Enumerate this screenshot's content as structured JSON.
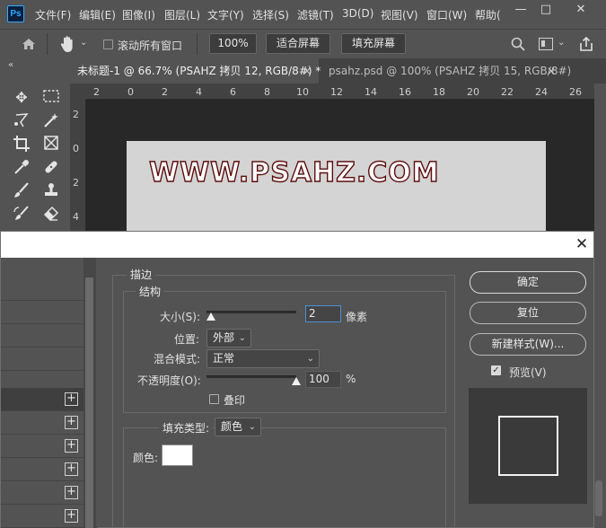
{
  "app": {
    "logo": "Ps"
  },
  "menu": [
    "文件(F)",
    "编辑(E)",
    "图像(I)",
    "图层(L)",
    "文字(Y)",
    "选择(S)",
    "滤镜(T)",
    "3D(D)",
    "视图(V)",
    "窗口(W)",
    "帮助("
  ],
  "window_controls": {
    "minimize": "—",
    "maximize": "□",
    "close": "✕"
  },
  "options_bar": {
    "scroll_all_label": "滚动所有窗口",
    "scroll_all_checked": false,
    "zoom_value": "100%",
    "fit_screen": "适合屏幕",
    "fill_screen": "填充屏幕"
  },
  "tabs": [
    {
      "label": "未标题-1 @ 66.7% (PSAHZ 拷贝 12, RGB/8#) *",
      "close": "×",
      "active": true
    },
    {
      "label": "psahz.psd @ 100% (PSAHZ 拷贝 15, RGB/8#)",
      "close": "×",
      "active": false
    }
  ],
  "ruler_h": [
    "2",
    "0",
    "2",
    "4",
    "6",
    "8",
    "10",
    "12",
    "14",
    "16",
    "18",
    "20",
    "22",
    "24",
    "26"
  ],
  "ruler_v": [
    "2",
    "0",
    "2",
    "4"
  ],
  "canvas": {
    "text": "WWW.PSAHZ.COM",
    "fill_color": "#ffffff",
    "stroke_color": "#5d0d0d"
  },
  "dialog": {
    "close": "✕",
    "styles_list": {
      "plus": "+"
    },
    "stroke": {
      "section_title": "描边",
      "structure_title": "结构",
      "size_label": "大小(S):",
      "size_value": "2",
      "size_unit": "像素",
      "position_label": "位置:",
      "position_value": "外部",
      "blend_label": "混合模式:",
      "blend_value": "正常",
      "opacity_label": "不透明度(O):",
      "opacity_value": "100",
      "opacity_unit": "%",
      "overprint_label": "叠印",
      "overprint_checked": false,
      "fill_type_label": "填充类型:",
      "fill_type_value": "颜色",
      "color_label": "颜色:",
      "color_value": "#ffffff"
    },
    "buttons": {
      "ok": "确定",
      "reset": "复位",
      "new_style": "新建样式(W)...",
      "preview_label": "预览(V)",
      "preview_checked": true
    }
  }
}
